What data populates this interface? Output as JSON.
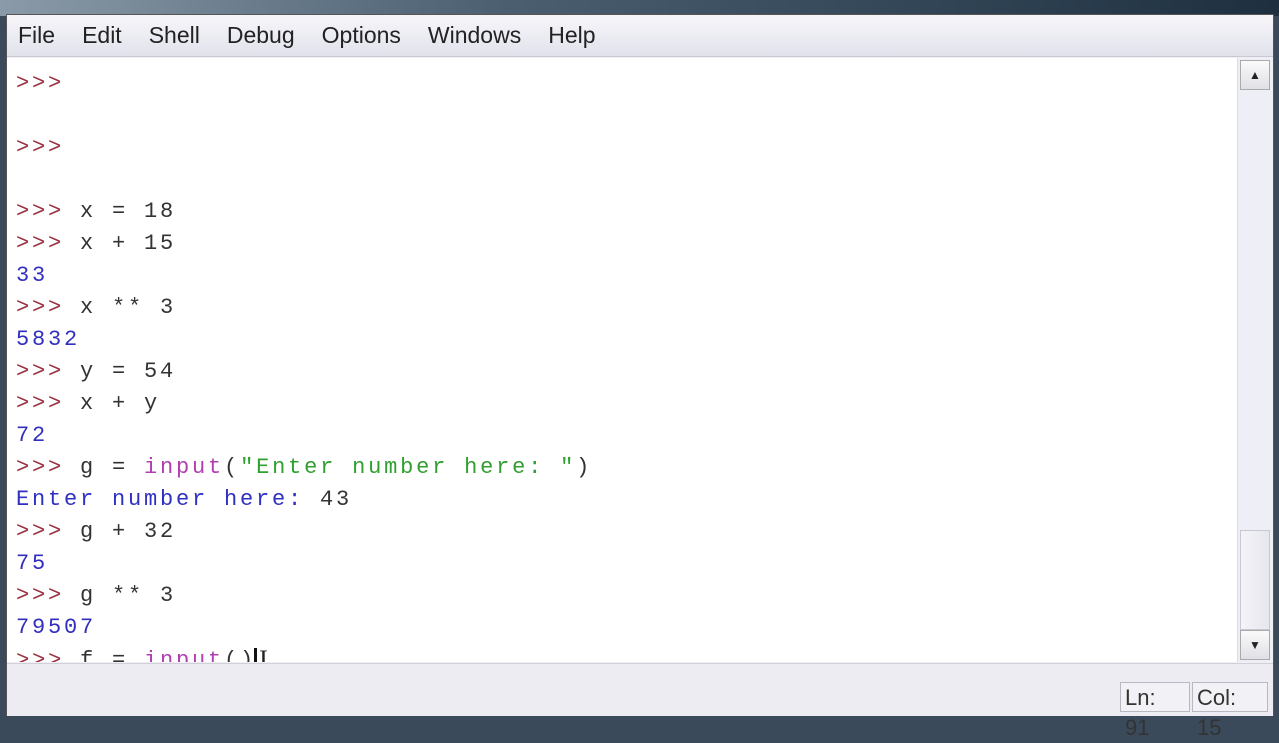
{
  "menu": [
    "File",
    "Edit",
    "Shell",
    "Debug",
    "Options",
    "Windows",
    "Help"
  ],
  "shell_lines": [
    [
      {
        "t": ">>> ",
        "c": "prompt"
      }
    ],
    [],
    [
      {
        "t": ">>> ",
        "c": "prompt"
      }
    ],
    [],
    [
      {
        "t": ">>> ",
        "c": "prompt"
      },
      {
        "t": "x = 18",
        "c": "usr"
      }
    ],
    [
      {
        "t": ">>> ",
        "c": "prompt"
      },
      {
        "t": "x + 15",
        "c": "usr"
      }
    ],
    [
      {
        "t": "33",
        "c": "out"
      }
    ],
    [
      {
        "t": ">>> ",
        "c": "prompt"
      },
      {
        "t": "x ** 3",
        "c": "usr"
      }
    ],
    [
      {
        "t": "5832",
        "c": "out"
      }
    ],
    [
      {
        "t": ">>> ",
        "c": "prompt"
      },
      {
        "t": "y = 54",
        "c": "usr"
      }
    ],
    [
      {
        "t": ">>> ",
        "c": "prompt"
      },
      {
        "t": "x + y",
        "c": "usr"
      }
    ],
    [
      {
        "t": "72",
        "c": "out"
      }
    ],
    [
      {
        "t": ">>> ",
        "c": "prompt"
      },
      {
        "t": "g = ",
        "c": "usr"
      },
      {
        "t": "input",
        "c": "kw"
      },
      {
        "t": "(",
        "c": "usr"
      },
      {
        "t": "\"Enter number here: \"",
        "c": "str"
      },
      {
        "t": ")",
        "c": "usr"
      }
    ],
    [
      {
        "t": "Enter number here: ",
        "c": "out"
      },
      {
        "t": "43",
        "c": "usr"
      }
    ],
    [
      {
        "t": ">>> ",
        "c": "prompt"
      },
      {
        "t": "g + 32",
        "c": "usr"
      }
    ],
    [
      {
        "t": "75",
        "c": "out"
      }
    ],
    [
      {
        "t": ">>> ",
        "c": "prompt"
      },
      {
        "t": "g ** 3",
        "c": "usr"
      }
    ],
    [
      {
        "t": "79507",
        "c": "out"
      }
    ],
    [
      {
        "t": ">>> ",
        "c": "prompt"
      },
      {
        "t": "f = ",
        "c": "usr"
      },
      {
        "t": "input",
        "c": "kw"
      },
      {
        "t": "()",
        "c": "usr"
      }
    ]
  ],
  "status": {
    "line": "Ln: 91",
    "col": "Col: 15"
  },
  "scrollbar": {
    "up": "▲",
    "down": "▼"
  }
}
